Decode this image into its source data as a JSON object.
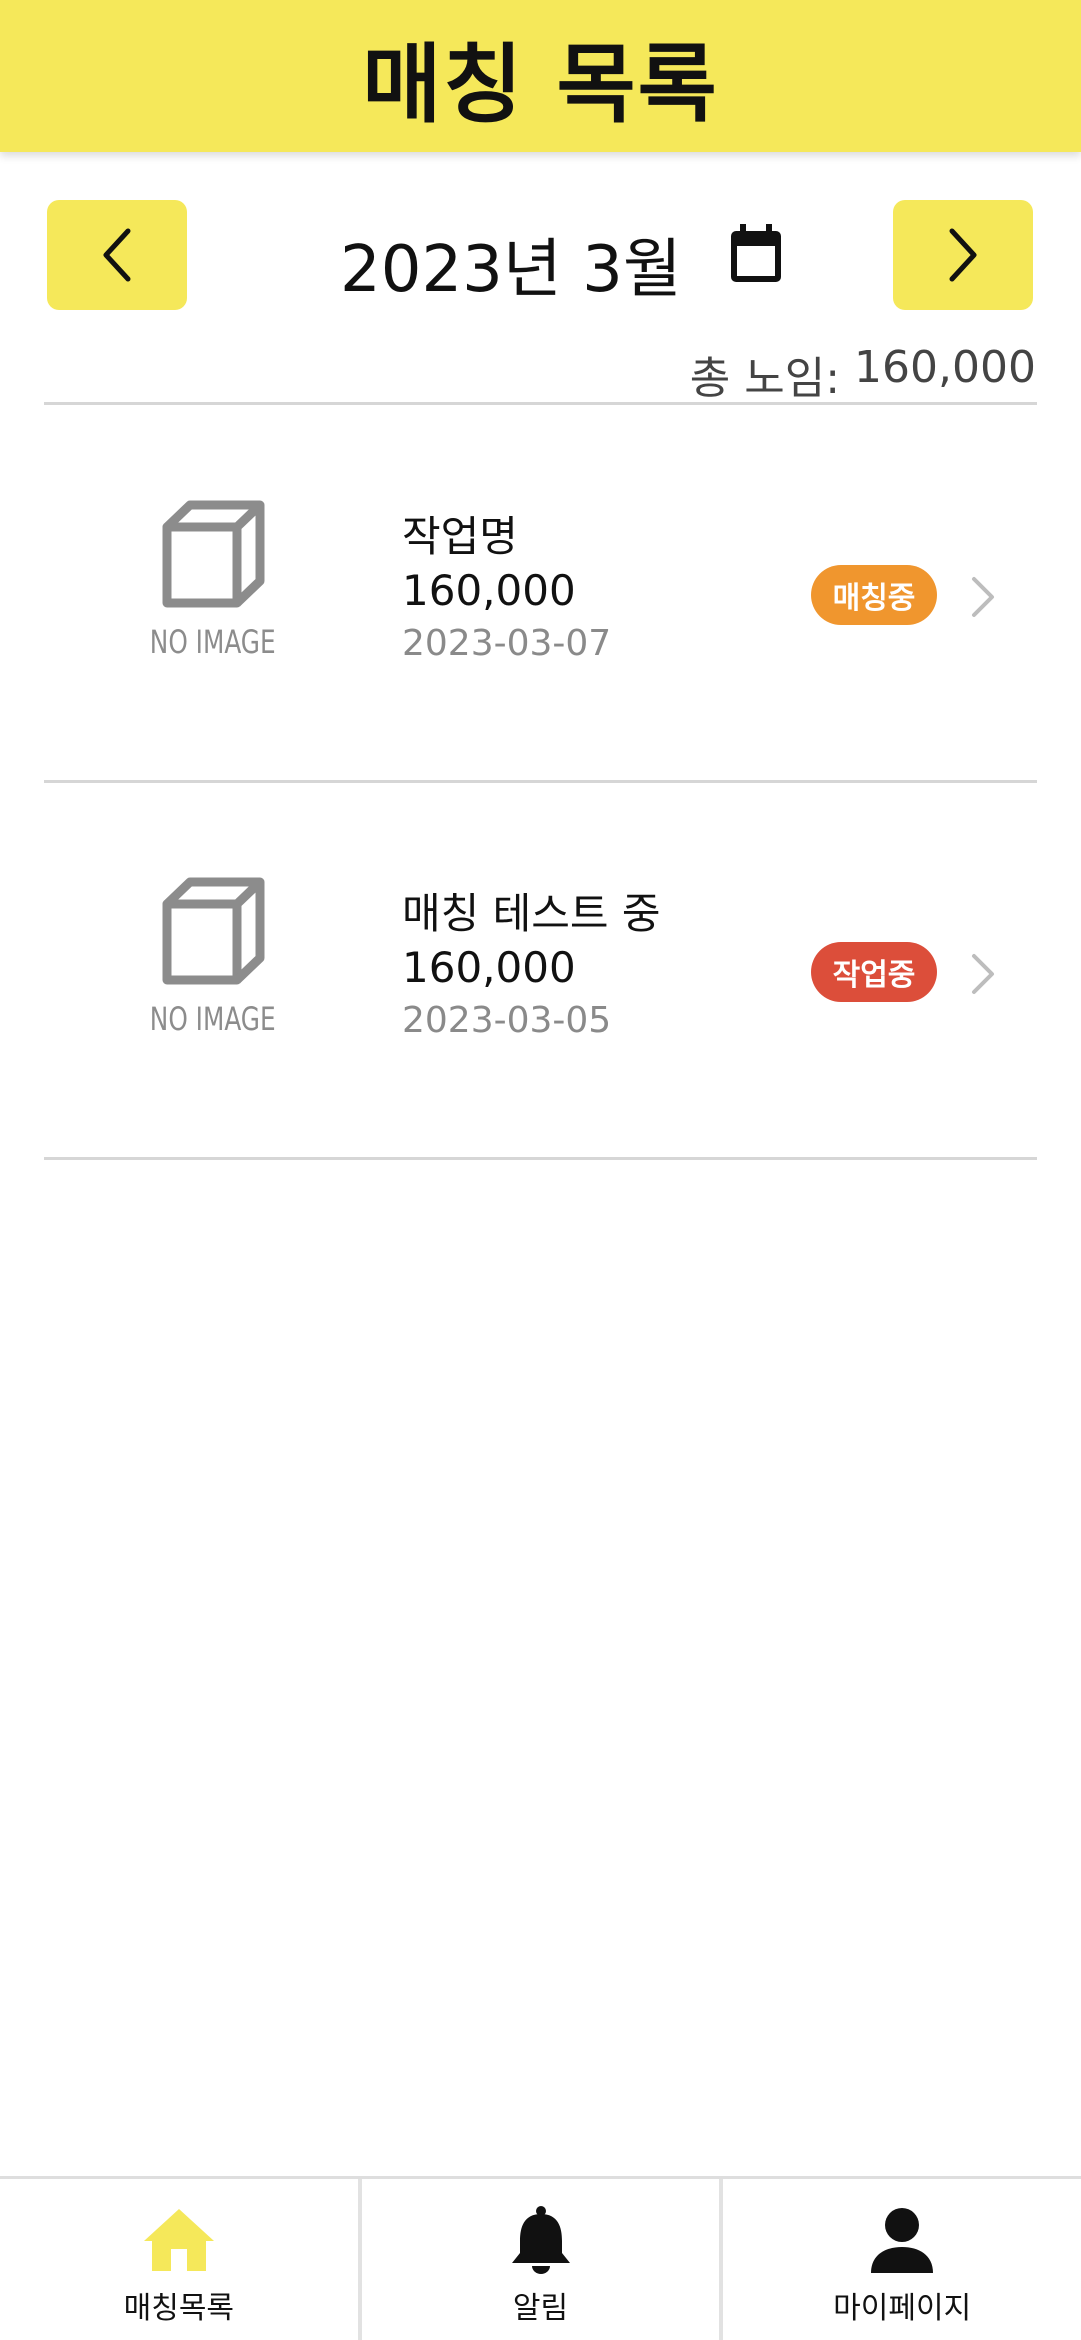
{
  "header": {
    "title": "매칭 목록"
  },
  "month_nav": {
    "prev_icon": "chevron-left-icon",
    "label": "2023년 3월",
    "calendar_icon": "calendar-icon",
    "next_icon": "chevron-right-icon"
  },
  "total": {
    "label": "총 노임:",
    "value": "160,000"
  },
  "items": [
    {
      "thumbnail_text": "NO IMAGE",
      "name": "작업명",
      "price": "160,000",
      "date": "2023-03-07",
      "status": "매칭중",
      "status_color": "#f0962e"
    },
    {
      "thumbnail_text": "NO IMAGE",
      "name": "매칭 테스트 중",
      "price": "160,000",
      "date": "2023-03-05",
      "status": "작업중",
      "status_color": "#dc4e3a"
    }
  ],
  "tabs": [
    {
      "label": "매칭목록",
      "icon": "home-icon",
      "active": true
    },
    {
      "label": "알림",
      "icon": "bell-icon",
      "active": false
    },
    {
      "label": "마이페이지",
      "icon": "user-icon",
      "active": false
    }
  ],
  "colors": {
    "brand_yellow": "#f5e85a",
    "status_matching": "#f0962e",
    "status_working": "#dc4e3a"
  }
}
